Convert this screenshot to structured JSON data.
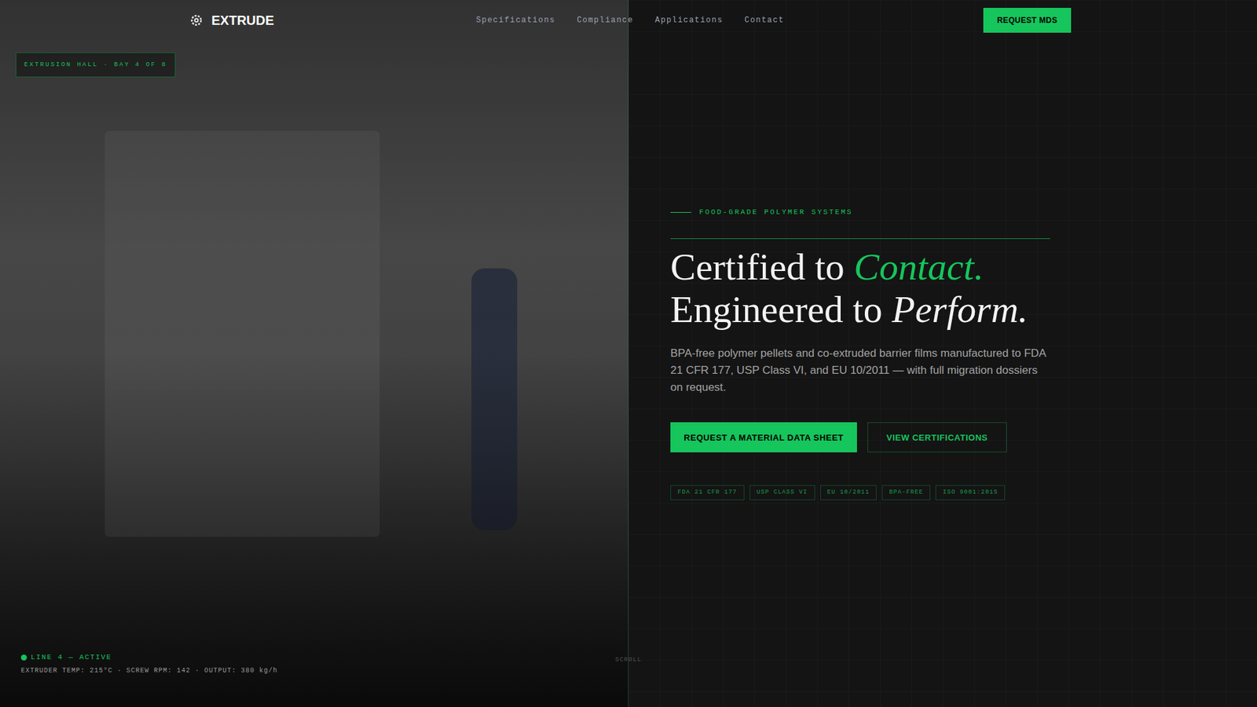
{
  "nav": {
    "logo": "EXTRUDE",
    "links": [
      {
        "label": "Specifications"
      },
      {
        "label": "Compliance"
      },
      {
        "label": "Applications"
      },
      {
        "label": "Contact"
      }
    ],
    "cta": "REQUEST MDS"
  },
  "photo_panel": {
    "badge": "EXTRUSION HALL · BAY 4 OF 8",
    "status": {
      "label": "LINE 4 — ACTIVE",
      "active": true,
      "readings": "EXTRUDER TEMP: 215°C · SCREW RPM: 142 · OUTPUT: 380 kg/h"
    }
  },
  "hero": {
    "eyebrow": "FOOD-GRADE POLYMER SYSTEMS",
    "heading": {
      "line1": "Certified to ",
      "accent1": "Contact.",
      "line2": "Engineered to ",
      "accent2": "Perform."
    },
    "body": "BPA-free polymer pellets and co-extruded barrier films manufactured to FDA 21 CFR 177, USP Class VI, and EU 10/2011 — with full migration dossiers on request.",
    "primary_button": "REQUEST A MATERIAL DATA SHEET",
    "secondary_button": "VIEW CERTIFICATIONS",
    "tags": [
      "FDA 21 CFR 177",
      "USP CLASS VI",
      "EU 10/2011",
      "BPA-FREE",
      "ISO 9001:2015"
    ]
  },
  "scroll": "SCROLL"
}
